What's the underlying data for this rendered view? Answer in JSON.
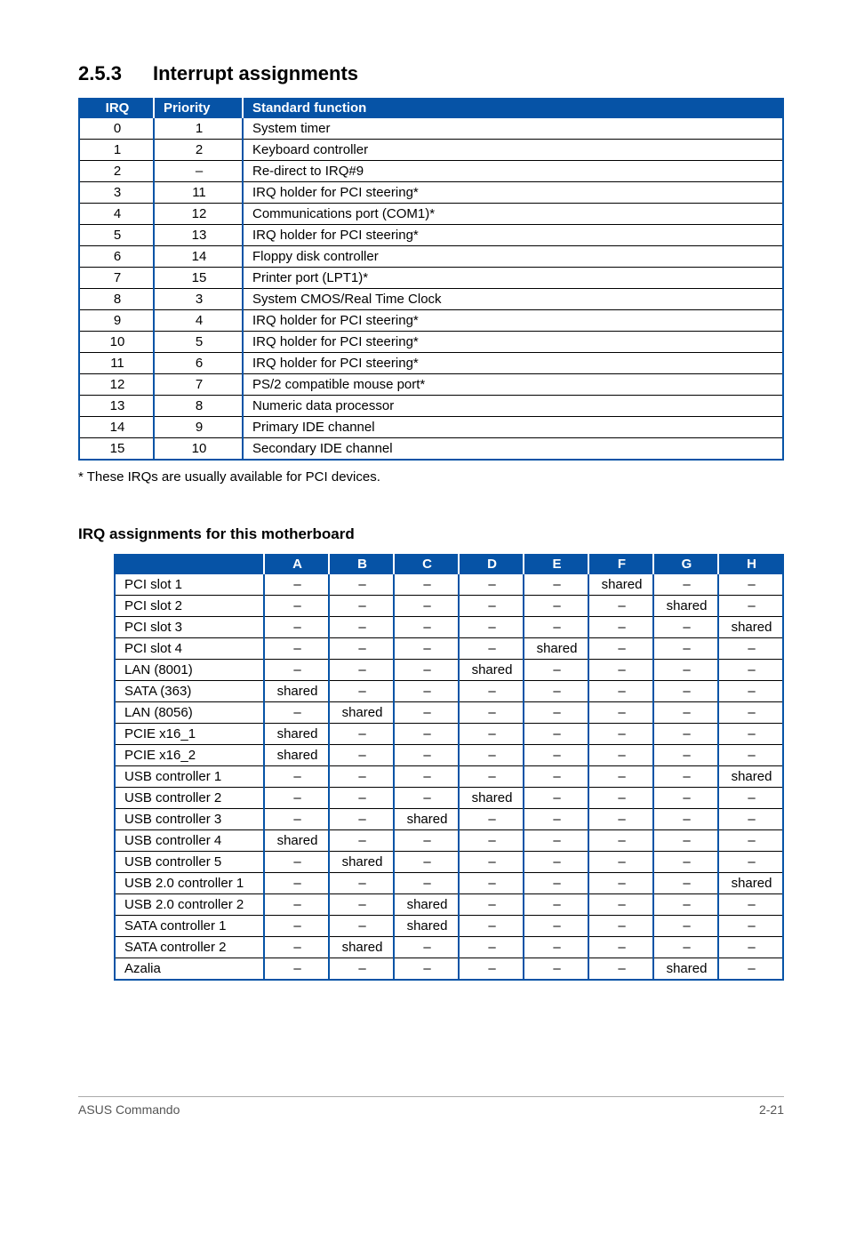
{
  "section": {
    "number": "2.5.3",
    "title": "Interrupt assignments"
  },
  "table1": {
    "headers": [
      "IRQ",
      "Priority",
      "Standard function"
    ],
    "rows": [
      [
        "0",
        "1",
        "System timer"
      ],
      [
        "1",
        "2",
        "Keyboard controller"
      ],
      [
        "2",
        "–",
        "Re-direct to IRQ#9"
      ],
      [
        "3",
        "11",
        "IRQ holder for PCI steering*"
      ],
      [
        "4",
        "12",
        "Communications port (COM1)*"
      ],
      [
        "5",
        "13",
        "IRQ holder for PCI steering*"
      ],
      [
        "6",
        "14",
        "Floppy disk controller"
      ],
      [
        "7",
        "15",
        "Printer port (LPT1)*"
      ],
      [
        "8",
        "3",
        "System CMOS/Real Time Clock"
      ],
      [
        "9",
        "4",
        "IRQ holder for PCI steering*"
      ],
      [
        "10",
        "5",
        "IRQ holder for PCI steering*"
      ],
      [
        "11",
        "6",
        "IRQ holder for PCI steering*"
      ],
      [
        "12",
        "7",
        "PS/2 compatible mouse port*"
      ],
      [
        "13",
        "8",
        "Numeric data processor"
      ],
      [
        "14",
        "9",
        "Primary IDE channel"
      ],
      [
        "15",
        "10",
        "Secondary IDE channel"
      ]
    ]
  },
  "footnote": "* These IRQs are usually available for PCI devices.",
  "subheading": "IRQ assignments for this motherboard",
  "table2": {
    "headers": [
      "",
      "A",
      "B",
      "C",
      "D",
      "E",
      "F",
      "G",
      "H"
    ],
    "rows": [
      [
        "PCI slot 1",
        "–",
        "–",
        "–",
        "–",
        "–",
        "shared",
        "–",
        "–"
      ],
      [
        "PCI slot 2",
        "–",
        "–",
        "–",
        "–",
        "–",
        "–",
        "shared",
        "–"
      ],
      [
        "PCI slot 3",
        "–",
        "–",
        "–",
        "–",
        "–",
        "–",
        "–",
        "shared"
      ],
      [
        "PCI slot 4",
        "–",
        "–",
        "–",
        "–",
        "shared",
        "–",
        "–",
        "–"
      ],
      [
        "LAN (8001)",
        "–",
        "–",
        "–",
        "shared",
        "–",
        "–",
        "–",
        "–"
      ],
      [
        "SATA (363)",
        "shared",
        "–",
        "–",
        "–",
        "–",
        "–",
        "–",
        "–"
      ],
      [
        "LAN (8056)",
        "–",
        "shared",
        "–",
        "–",
        "–",
        "–",
        "–",
        "–"
      ],
      [
        "PCIE x16_1",
        "shared",
        "–",
        "–",
        "–",
        "–",
        "–",
        "–",
        "–"
      ],
      [
        "PCIE x16_2",
        "shared",
        "–",
        "–",
        "–",
        "–",
        "–",
        "–",
        "–"
      ],
      [
        "USB controller 1",
        "–",
        "–",
        "–",
        "–",
        "–",
        "–",
        "–",
        "shared"
      ],
      [
        "USB controller 2",
        "–",
        "–",
        "–",
        "shared",
        "–",
        "–",
        "–",
        "–"
      ],
      [
        "USB controller 3",
        "–",
        "–",
        "shared",
        "–",
        "–",
        "–",
        "–",
        "–"
      ],
      [
        "USB controller 4",
        "shared",
        "–",
        "–",
        "–",
        "–",
        "–",
        "–",
        "–"
      ],
      [
        "USB controller 5",
        "–",
        "shared",
        "–",
        "–",
        "–",
        "–",
        "–",
        "–"
      ],
      [
        "USB 2.0 controller 1",
        "–",
        "–",
        "–",
        "–",
        "–",
        "–",
        "–",
        "shared"
      ],
      [
        "USB 2.0 controller 2",
        "–",
        "–",
        "shared",
        "–",
        "–",
        "–",
        "–",
        "–"
      ],
      [
        "SATA controller 1",
        "–",
        "–",
        "shared",
        "–",
        "–",
        "–",
        "–",
        "–"
      ],
      [
        "SATA controller 2",
        "–",
        "shared",
        "–",
        "–",
        "–",
        "–",
        "–",
        "–"
      ],
      [
        "Azalia",
        "–",
        "–",
        "–",
        "–",
        "–",
        "–",
        "shared",
        "–"
      ]
    ]
  },
  "footer": {
    "left": "ASUS Commando",
    "right": "2-21"
  }
}
